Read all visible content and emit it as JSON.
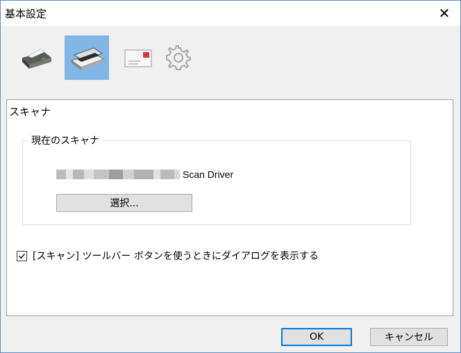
{
  "window": {
    "title": "基本設定",
    "close_glyph": "✕"
  },
  "toolbar": {
    "items": [
      {
        "name": "printer",
        "selected": false
      },
      {
        "name": "scanner",
        "selected": true
      },
      {
        "name": "mail",
        "selected": false
      },
      {
        "name": "settings",
        "selected": false
      }
    ]
  },
  "panel": {
    "title": "スキャナ",
    "group": {
      "legend": "現在のスキャナ",
      "scanner_name": "Scan Driver",
      "select_label": "選択..."
    },
    "checkbox": {
      "checked": true,
      "label": "[スキャン] ツールバー ボタンを使うときにダイアログを表示する"
    }
  },
  "footer": {
    "ok_label": "OK",
    "cancel_label": "キャンセル"
  },
  "colors": {
    "selected_tab": "#81b6e5",
    "default_button_border": "#0078d7"
  }
}
